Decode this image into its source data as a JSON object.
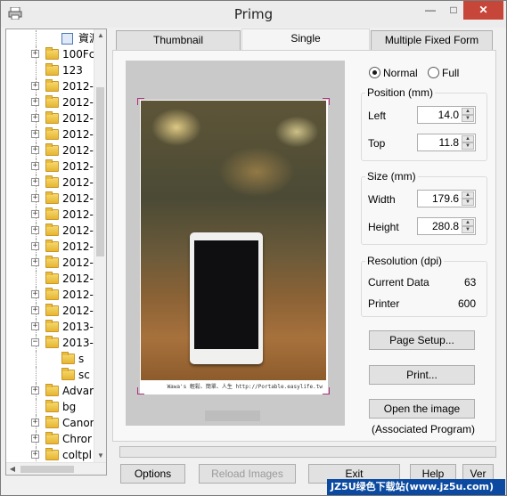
{
  "window": {
    "title": "Primg"
  },
  "tree": {
    "items": [
      {
        "label": "資源回",
        "level": 1,
        "expander": "",
        "icon": "file"
      },
      {
        "label": "100Fc",
        "level": 0,
        "expander": "+",
        "icon": "folder"
      },
      {
        "label": "123",
        "level": 0,
        "expander": "",
        "icon": "folder"
      },
      {
        "label": "2012-",
        "level": 0,
        "expander": "+",
        "icon": "folder"
      },
      {
        "label": "2012-",
        "level": 0,
        "expander": "+",
        "icon": "folder"
      },
      {
        "label": "2012-",
        "level": 0,
        "expander": "+",
        "icon": "folder"
      },
      {
        "label": "2012-",
        "level": 0,
        "expander": "+",
        "icon": "folder"
      },
      {
        "label": "2012-",
        "level": 0,
        "expander": "+",
        "icon": "folder"
      },
      {
        "label": "2012-",
        "level": 0,
        "expander": "+",
        "icon": "folder"
      },
      {
        "label": "2012-",
        "level": 0,
        "expander": "+",
        "icon": "folder"
      },
      {
        "label": "2012-",
        "level": 0,
        "expander": "+",
        "icon": "folder"
      },
      {
        "label": "2012-",
        "level": 0,
        "expander": "+",
        "icon": "folder"
      },
      {
        "label": "2012-",
        "level": 0,
        "expander": "+",
        "icon": "folder"
      },
      {
        "label": "2012-",
        "level": 0,
        "expander": "+",
        "icon": "folder"
      },
      {
        "label": "2012-",
        "level": 0,
        "expander": "+",
        "icon": "folder"
      },
      {
        "label": "2012-",
        "level": 0,
        "expander": "",
        "icon": "folder"
      },
      {
        "label": "2012-",
        "level": 0,
        "expander": "+",
        "icon": "folder"
      },
      {
        "label": "2012-",
        "level": 0,
        "expander": "+",
        "icon": "folder"
      },
      {
        "label": "2013-",
        "level": 0,
        "expander": "+",
        "icon": "folder"
      },
      {
        "label": "2013-",
        "level": 0,
        "expander": "−",
        "icon": "folder"
      },
      {
        "label": "s",
        "level": 1,
        "expander": "",
        "icon": "folder"
      },
      {
        "label": "sc",
        "level": 1,
        "expander": "",
        "icon": "folder"
      },
      {
        "label": "Advar",
        "level": 0,
        "expander": "+",
        "icon": "folder"
      },
      {
        "label": "bg",
        "level": 0,
        "expander": "",
        "icon": "folder"
      },
      {
        "label": "Canor",
        "level": 0,
        "expander": "+",
        "icon": "folder"
      },
      {
        "label": "Chror",
        "level": 0,
        "expander": "+",
        "icon": "folder"
      },
      {
        "label": "coltpl",
        "level": 0,
        "expander": "+",
        "icon": "folder"
      }
    ]
  },
  "tabs": [
    {
      "label": "Thumbnail",
      "active": false
    },
    {
      "label": "Single",
      "active": true
    },
    {
      "label": "Multiple Fixed Form",
      "active": false
    }
  ],
  "preview": {
    "caption": "Wawa's 輕鬆、簡單、人生 http://Portable.easylife.tw"
  },
  "mode": {
    "normal_label": "Normal",
    "full_label": "Full",
    "selected": "Normal"
  },
  "position": {
    "title": "Position (mm)",
    "left_label": "Left",
    "left_value": "14.0",
    "top_label": "Top",
    "top_value": "11.8"
  },
  "size": {
    "title": "Size (mm)",
    "width_label": "Width",
    "width_value": "179.6",
    "height_label": "Height",
    "height_value": "280.8"
  },
  "resolution": {
    "title": "Resolution (dpi)",
    "current_label": "Current Data",
    "current_value": "63",
    "printer_label": "Printer",
    "printer_value": "600"
  },
  "actions": {
    "page_setup": "Page Setup...",
    "print": "Print...",
    "open_image": "Open the image",
    "associated": "(Associated Program)"
  },
  "footer": {
    "options": "Options",
    "reload": "Reload Images",
    "exit": "Exit",
    "help": "Help",
    "ver": "Ver"
  },
  "watermark": "JZ5U绿色下载站(www.jz5u.com)"
}
